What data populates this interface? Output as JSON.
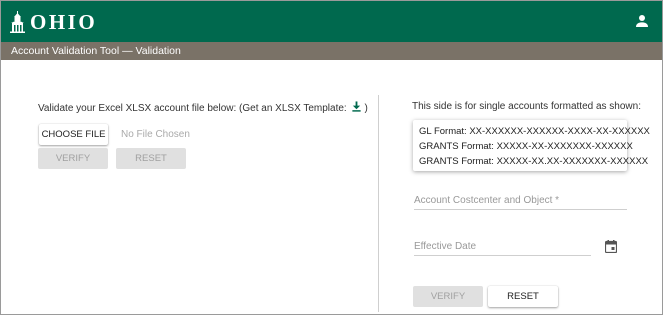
{
  "header": {
    "logo_text": "OHIO",
    "user_icon": "account-person-icon",
    "colors": {
      "brand_green": "#00694e",
      "subbar_gray": "#7a7267"
    }
  },
  "subbar": {
    "title": "Account Validation Tool — Validation"
  },
  "left_panel": {
    "instruction_prefix": "Validate your Excel XLSX account file below: (Get an XLSX Template:",
    "instruction_suffix": ")",
    "download_icon": "download-icon",
    "choose_file_label": "CHOOSE FILE",
    "file_status": "No File Chosen",
    "verify_label": "VERIFY",
    "reset_label": "RESET"
  },
  "right_panel": {
    "instruction": "This side is for single accounts formatted as shown:",
    "formats": [
      "GL Format: XX-XXXXXX-XXXXXX-XXXX-XX-XXXXXX",
      "GRANTS Format: XXXXX-XX-XXXXXXX-XXXXXX",
      "GRANTS Format: XXXXX-XX.XX-XXXXXXX-XXXXXX"
    ],
    "account_field_label": "Account Costcenter and Object *",
    "date_field_label": "Effective Date",
    "calendar_icon": "calendar-icon",
    "verify_label": "VERIFY",
    "reset_label": "RESET"
  }
}
